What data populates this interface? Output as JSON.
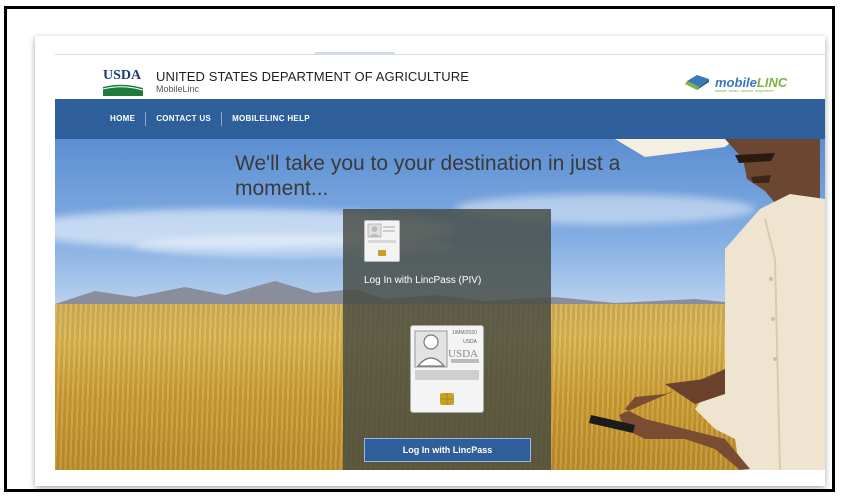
{
  "header": {
    "logo_text": "USDA",
    "agency_title": "UNITED STATES DEPARTMENT OF AGRICULTURE",
    "agency_subtitle": "MobileLinc",
    "brand_prefix": "mobile",
    "brand_suffix": "LINC",
    "brand_tagline": "simple. smart. secure. anywhere!"
  },
  "nav": {
    "items": [
      {
        "label": "HOME"
      },
      {
        "label": "CONTACT US"
      },
      {
        "label": "MOBILELINC HELP"
      }
    ]
  },
  "hero": {
    "headline": "We'll take you to your destination in just a moment..."
  },
  "login": {
    "piv_label": "Log In with LincPass (PIV)",
    "button_label": "Log In with LincPass",
    "card_date": "1/MM/2020",
    "card_agency": "USDA",
    "card_logo": "USDA"
  },
  "colors": {
    "nav_bg": "#2e5f9b",
    "button_bg": "#2e5f9b",
    "brand_blue": "#3a79b9",
    "brand_green": "#7ab540"
  }
}
